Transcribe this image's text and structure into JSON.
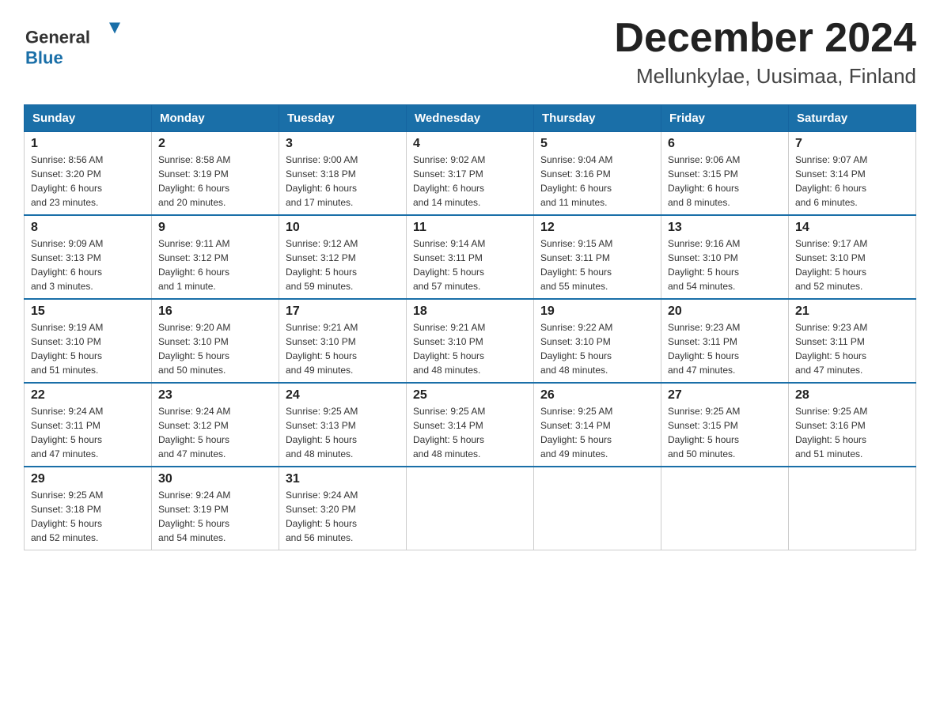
{
  "logo": {
    "general_text": "General",
    "blue_text": "Blue"
  },
  "header": {
    "title": "December 2024",
    "subtitle": "Mellunkylae, Uusimaa, Finland"
  },
  "days_of_week": [
    "Sunday",
    "Monday",
    "Tuesday",
    "Wednesday",
    "Thursday",
    "Friday",
    "Saturday"
  ],
  "weeks": [
    [
      {
        "day": "1",
        "sunrise": "8:56 AM",
        "sunset": "3:20 PM",
        "daylight": "6 hours and 23 minutes."
      },
      {
        "day": "2",
        "sunrise": "8:58 AM",
        "sunset": "3:19 PM",
        "daylight": "6 hours and 20 minutes."
      },
      {
        "day": "3",
        "sunrise": "9:00 AM",
        "sunset": "3:18 PM",
        "daylight": "6 hours and 17 minutes."
      },
      {
        "day": "4",
        "sunrise": "9:02 AM",
        "sunset": "3:17 PM",
        "daylight": "6 hours and 14 minutes."
      },
      {
        "day": "5",
        "sunrise": "9:04 AM",
        "sunset": "3:16 PM",
        "daylight": "6 hours and 11 minutes."
      },
      {
        "day": "6",
        "sunrise": "9:06 AM",
        "sunset": "3:15 PM",
        "daylight": "6 hours and 8 minutes."
      },
      {
        "day": "7",
        "sunrise": "9:07 AM",
        "sunset": "3:14 PM",
        "daylight": "6 hours and 6 minutes."
      }
    ],
    [
      {
        "day": "8",
        "sunrise": "9:09 AM",
        "sunset": "3:13 PM",
        "daylight": "6 hours and 3 minutes."
      },
      {
        "day": "9",
        "sunrise": "9:11 AM",
        "sunset": "3:12 PM",
        "daylight": "6 hours and 1 minute."
      },
      {
        "day": "10",
        "sunrise": "9:12 AM",
        "sunset": "3:12 PM",
        "daylight": "5 hours and 59 minutes."
      },
      {
        "day": "11",
        "sunrise": "9:14 AM",
        "sunset": "3:11 PM",
        "daylight": "5 hours and 57 minutes."
      },
      {
        "day": "12",
        "sunrise": "9:15 AM",
        "sunset": "3:11 PM",
        "daylight": "5 hours and 55 minutes."
      },
      {
        "day": "13",
        "sunrise": "9:16 AM",
        "sunset": "3:10 PM",
        "daylight": "5 hours and 54 minutes."
      },
      {
        "day": "14",
        "sunrise": "9:17 AM",
        "sunset": "3:10 PM",
        "daylight": "5 hours and 52 minutes."
      }
    ],
    [
      {
        "day": "15",
        "sunrise": "9:19 AM",
        "sunset": "3:10 PM",
        "daylight": "5 hours and 51 minutes."
      },
      {
        "day": "16",
        "sunrise": "9:20 AM",
        "sunset": "3:10 PM",
        "daylight": "5 hours and 50 minutes."
      },
      {
        "day": "17",
        "sunrise": "9:21 AM",
        "sunset": "3:10 PM",
        "daylight": "5 hours and 49 minutes."
      },
      {
        "day": "18",
        "sunrise": "9:21 AM",
        "sunset": "3:10 PM",
        "daylight": "5 hours and 48 minutes."
      },
      {
        "day": "19",
        "sunrise": "9:22 AM",
        "sunset": "3:10 PM",
        "daylight": "5 hours and 48 minutes."
      },
      {
        "day": "20",
        "sunrise": "9:23 AM",
        "sunset": "3:11 PM",
        "daylight": "5 hours and 47 minutes."
      },
      {
        "day": "21",
        "sunrise": "9:23 AM",
        "sunset": "3:11 PM",
        "daylight": "5 hours and 47 minutes."
      }
    ],
    [
      {
        "day": "22",
        "sunrise": "9:24 AM",
        "sunset": "3:11 PM",
        "daylight": "5 hours and 47 minutes."
      },
      {
        "day": "23",
        "sunrise": "9:24 AM",
        "sunset": "3:12 PM",
        "daylight": "5 hours and 47 minutes."
      },
      {
        "day": "24",
        "sunrise": "9:25 AM",
        "sunset": "3:13 PM",
        "daylight": "5 hours and 48 minutes."
      },
      {
        "day": "25",
        "sunrise": "9:25 AM",
        "sunset": "3:14 PM",
        "daylight": "5 hours and 48 minutes."
      },
      {
        "day": "26",
        "sunrise": "9:25 AM",
        "sunset": "3:14 PM",
        "daylight": "5 hours and 49 minutes."
      },
      {
        "day": "27",
        "sunrise": "9:25 AM",
        "sunset": "3:15 PM",
        "daylight": "5 hours and 50 minutes."
      },
      {
        "day": "28",
        "sunrise": "9:25 AM",
        "sunset": "3:16 PM",
        "daylight": "5 hours and 51 minutes."
      }
    ],
    [
      {
        "day": "29",
        "sunrise": "9:25 AM",
        "sunset": "3:18 PM",
        "daylight": "5 hours and 52 minutes."
      },
      {
        "day": "30",
        "sunrise": "9:24 AM",
        "sunset": "3:19 PM",
        "daylight": "5 hours and 54 minutes."
      },
      {
        "day": "31",
        "sunrise": "9:24 AM",
        "sunset": "3:20 PM",
        "daylight": "5 hours and 56 minutes."
      },
      null,
      null,
      null,
      null
    ]
  ],
  "labels": {
    "sunrise": "Sunrise:",
    "sunset": "Sunset:",
    "daylight": "Daylight:"
  }
}
